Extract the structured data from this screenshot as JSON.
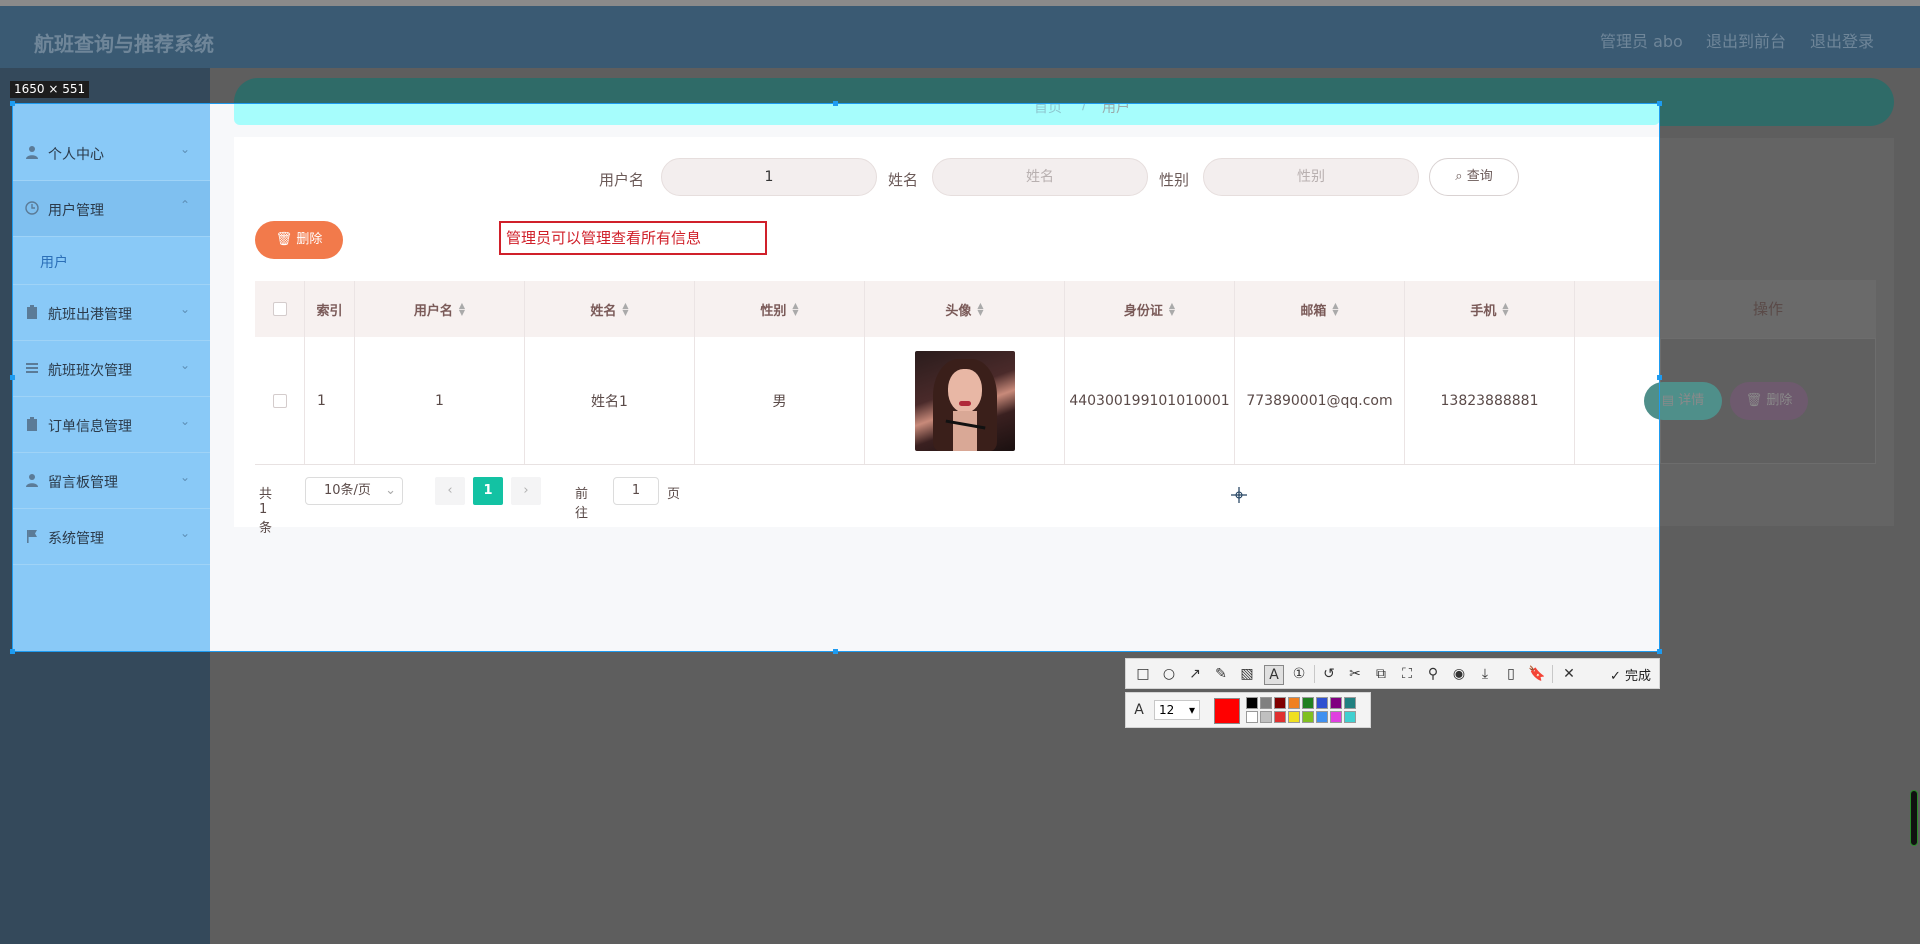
{
  "header": {
    "brand": "航班查询与推荐系统",
    "admin": "管理员 abo",
    "to_front": "退出到前台",
    "logout": "退出登录"
  },
  "breadcrumb": {
    "home": "首页",
    "sep": "/",
    "current": "用户"
  },
  "sidebar": {
    "items": [
      {
        "label": "个人中心",
        "icon": "person-icon"
      },
      {
        "label": "用户管理",
        "icon": "clock-icon"
      },
      {
        "label": "用户",
        "icon": ""
      },
      {
        "label": "航班出港管理",
        "icon": "clipboard-icon"
      },
      {
        "label": "航班班次管理",
        "icon": "list-icon"
      },
      {
        "label": "订单信息管理",
        "icon": "clipboard-icon"
      },
      {
        "label": "留言板管理",
        "icon": "person-icon"
      },
      {
        "label": "系统管理",
        "icon": "flag-icon"
      }
    ]
  },
  "search": {
    "username_label": "用户名",
    "username_value": "1",
    "name_label": "姓名",
    "name_placeholder": "姓名",
    "gender_label": "性别",
    "gender_placeholder": "性别",
    "query_button": "查询"
  },
  "actions": {
    "delete_button": "删除"
  },
  "annotation_text": "管理员可以管理查看所有信息",
  "table": {
    "headers": [
      "索引",
      "用户名",
      "姓名",
      "性别",
      "头像",
      "身份证",
      "邮箱",
      "手机",
      "操作"
    ],
    "rows": [
      {
        "index": "1",
        "username": "1",
        "name": "姓名1",
        "gender": "男",
        "id_card": "440300199101010001",
        "email": "773890001@qq.com",
        "phone": "13823888881",
        "detail_button": "详情",
        "delete_button": "删除"
      }
    ]
  },
  "pager": {
    "total": "共 1 条",
    "page_size": "10条/页",
    "current_page": "1",
    "goto_label": "前往",
    "goto_value": "1",
    "page_suffix": "页"
  },
  "capture_tool": {
    "size_label": "1650 × 551",
    "done_label": "完成",
    "font_size": "12",
    "current_color": "#ff0000",
    "palette_top": [
      "#000000",
      "#808080",
      "#800000",
      "#f08020",
      "#208020",
      "#3050d0",
      "#800080",
      "#208080"
    ],
    "palette_bottom": [
      "#ffffff",
      "#c0c0c0",
      "#e03030",
      "#f0e020",
      "#80c020",
      "#4090f0",
      "#e040e0",
      "#40d0d0"
    ]
  }
}
